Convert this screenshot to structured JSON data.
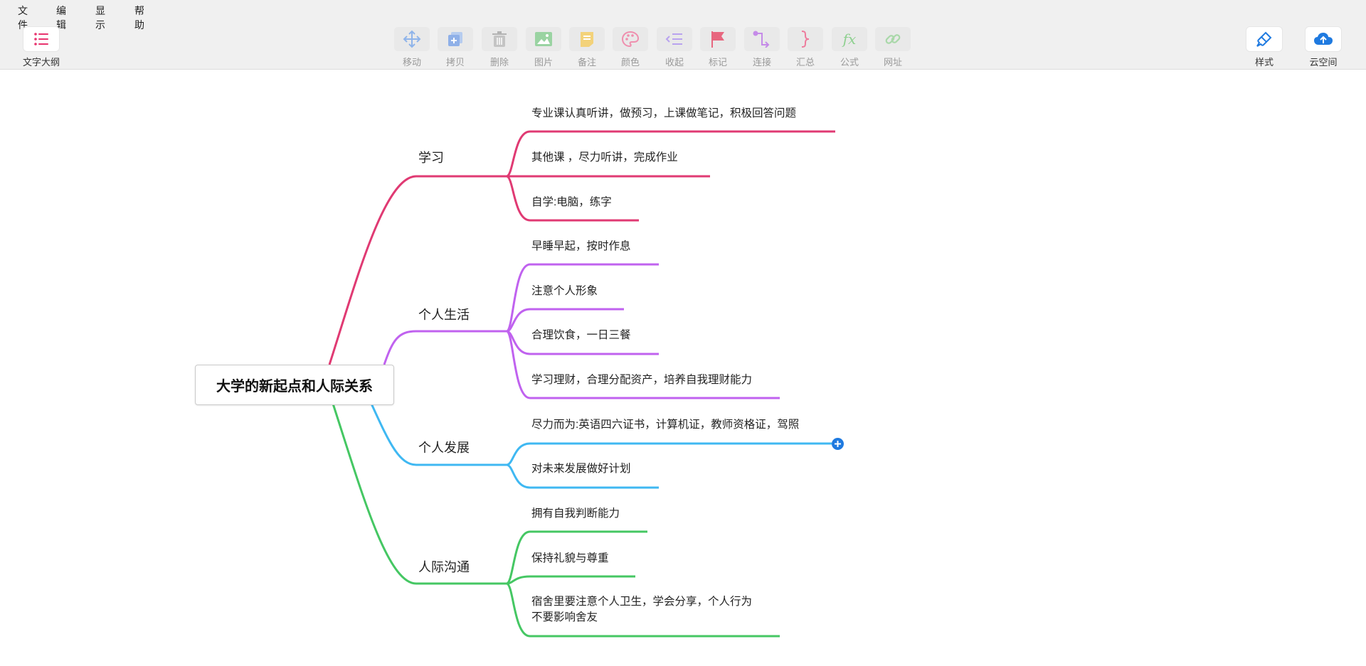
{
  "menu": {
    "file": "文件",
    "edit": "编辑",
    "view": "显示",
    "help": "帮助"
  },
  "toolbar": {
    "outline": "文字大纲",
    "move": "移动",
    "copy": "拷贝",
    "delete": "删除",
    "image": "图片",
    "note": "备注",
    "color": "颜色",
    "collapse": "收起",
    "mark": "标记",
    "connect": "连接",
    "summary": "汇总",
    "formula": "公式",
    "link": "网址",
    "style": "样式",
    "cloud": "云空间"
  },
  "icons": {
    "outline": "list-icon",
    "move": "move-arrows-icon",
    "copy": "copy-plus-icon",
    "delete": "trash-icon",
    "image": "image-icon",
    "note": "note-icon",
    "color": "palette-icon",
    "collapse": "collapse-icon",
    "mark": "flag-icon",
    "connect": "connector-icon",
    "summary": "brace-icon",
    "formula": "fx-icon",
    "link": "chain-link-icon",
    "style": "paint-brush-icon",
    "cloud": "cloud-upload-icon",
    "add_child": "plus-circle-icon"
  },
  "colors": {
    "study": "#e03a73",
    "life": "#c062ef",
    "development": "#3fb8f2",
    "communication": "#45c763",
    "accent_blue": "#1f7ae0",
    "outline_icon": "#e8336e"
  },
  "mindmap": {
    "root": "大学的新起点和人际关系",
    "branches": [
      {
        "title": "学习",
        "children": [
          "专业课认真听讲，做预习，上课做笔记，积极回答问题",
          "其他课 ，尽力听讲，完成作业",
          "自学:电脑，练字"
        ]
      },
      {
        "title": "个人生活",
        "children": [
          "早睡早起，按时作息",
          "注意个人形象",
          "合理饮食，一日三餐",
          "学习理财，合理分配资产，培养自我理财能力"
        ]
      },
      {
        "title": "个人发展",
        "children": [
          "尽力而为:英语四六证书，计算机证，教师资格证，驾照",
          "对未来发展做好计划"
        ]
      },
      {
        "title": "人际沟通",
        "children": [
          "拥有自我判断能力",
          "保持礼貌与尊重",
          "宿舍里要注意个人卫生，学会分享，个人行为",
          "不要影响舍友"
        ]
      }
    ]
  }
}
